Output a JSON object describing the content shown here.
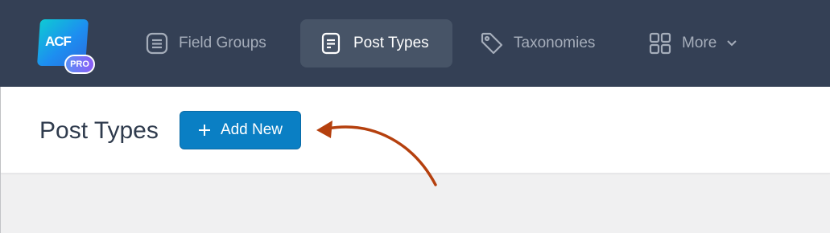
{
  "logo": {
    "text": "ACF",
    "badge": "PRO"
  },
  "nav": {
    "items": [
      {
        "label": "Field Groups",
        "icon": "list-icon"
      },
      {
        "label": "Post Types",
        "icon": "document-icon",
        "active": true
      },
      {
        "label": "Taxonomies",
        "icon": "tag-icon"
      },
      {
        "label": "More",
        "icon": "grid-icon"
      }
    ]
  },
  "page": {
    "title": "Post Types",
    "add_button_label": "Add New"
  },
  "colors": {
    "topbar": "#344055",
    "active_nav": "#475467",
    "button": "#0a7fc4",
    "arrow": "#b5400e"
  }
}
